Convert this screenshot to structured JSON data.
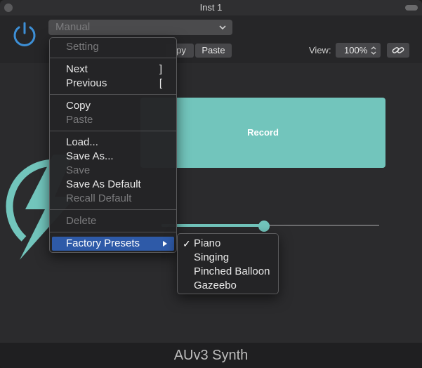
{
  "window": {
    "title": "Inst 1"
  },
  "header": {
    "preset_value": "Manual",
    "copy_label": "py",
    "paste_label": "Paste",
    "view_label": "View:",
    "zoom_value": "100%"
  },
  "content": {
    "record_label": "Record",
    "slider_value_fraction": 0.47
  },
  "footer": {
    "plugin_name": "AUv3 Synth"
  },
  "menu": {
    "items": [
      {
        "label": "Setting",
        "disabled": true
      },
      {
        "label": "Next",
        "key": "]"
      },
      {
        "label": "Previous",
        "key": "["
      },
      {
        "label": "Copy"
      },
      {
        "label": "Paste",
        "disabled": true
      },
      {
        "label": "Load..."
      },
      {
        "label": "Save As..."
      },
      {
        "label": "Save",
        "disabled": true
      },
      {
        "label": "Save As Default"
      },
      {
        "label": "Recall Default",
        "disabled": true
      },
      {
        "label": "Delete",
        "disabled": true
      },
      {
        "label": "Factory Presets",
        "highlighted": true,
        "submenu": true
      }
    ]
  },
  "submenu": {
    "checkmark": "✓",
    "items": [
      {
        "label": "Piano",
        "checked": true
      },
      {
        "label": "Singing"
      },
      {
        "label": "Pinched Balloon"
      },
      {
        "label": "Gazeebo"
      }
    ]
  },
  "colors": {
    "accent": "#72c5bc",
    "power_icon": "#3d8fd6",
    "menu_highlight": "#2e5aa8"
  },
  "icons": [
    "power-icon",
    "chevron-down-icon",
    "stepper-icon",
    "link-icon",
    "lightning-bolt-icon",
    "submenu-arrow-icon",
    "checkmark-icon"
  ]
}
